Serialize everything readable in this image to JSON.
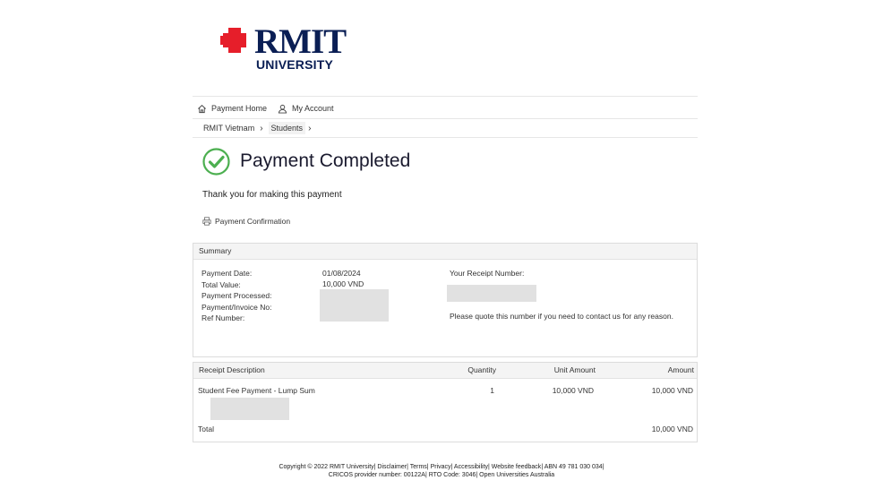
{
  "brand": {
    "name": "RMIT",
    "sub": "UNIVERSITY",
    "color": "#0a1e54",
    "accent": "#e61e2a"
  },
  "nav": [
    {
      "label": "Payment Home",
      "icon": "home-icon"
    },
    {
      "label": "My Account",
      "icon": "user-icon"
    }
  ],
  "breadcrumb": [
    {
      "label": "RMIT Vietnam"
    },
    {
      "label": "Students"
    }
  ],
  "status": {
    "title": "Payment Completed",
    "icon": "check-circle-icon",
    "color": "#4caf50"
  },
  "message": "Thank you for making this payment",
  "confirmation_link": {
    "label": "Payment Confirmation",
    "icon": "printer-icon"
  },
  "summary": {
    "heading": "Summary",
    "labels": {
      "date": "Payment Date:",
      "total": "Total Value:",
      "processed": "Payment Processed:",
      "invoice": "Payment/Invoice No:",
      "ref": "Ref Number:"
    },
    "values": {
      "date": "01/08/2024",
      "total": "10,000 VND"
    },
    "receipt_label": "Your Receipt Number:",
    "quote_note": "Please quote this number if you need to contact us for any reason."
  },
  "receipt_table": {
    "headers": {
      "description": "Receipt Description",
      "quantity": "Quantity",
      "unit": "Unit Amount",
      "amount": "Amount"
    },
    "row": {
      "description": "Student Fee Payment - Lump Sum",
      "quantity": "1",
      "unit": "10,000 VND",
      "amount": "10,000 VND"
    },
    "total_label": "Total",
    "total_value": "10,000 VND"
  },
  "footer": {
    "copyright": "Copyright © 2022 RMIT University",
    "links": [
      "Disclaimer",
      "Terms",
      "Privacy",
      "Accessibility",
      "Website feedback"
    ],
    "abn": "ABN 49 781 030 034",
    "line2_cricos": "CRICOS provider number: 00122A",
    "line2_rto": "RTO Code: 3046",
    "line2_oua": "Open Universities Australia"
  }
}
